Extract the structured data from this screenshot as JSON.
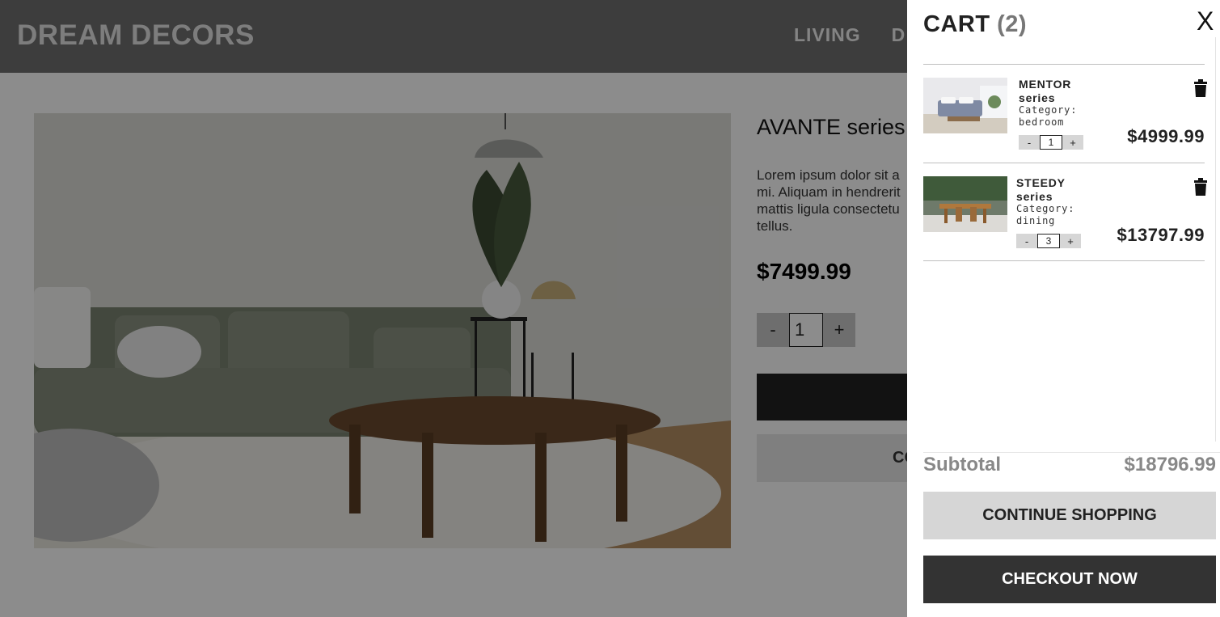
{
  "header": {
    "brand": "DREAM DECORS",
    "nav": [
      "LIVING",
      "D"
    ]
  },
  "product": {
    "title": "AVANTE series",
    "description_lines": [
      "Lorem ipsum dolor sit a",
      "mi. Aliquam in hendrerit",
      "mattis ligula consectetu",
      "tellus."
    ],
    "price": "$7499.99",
    "qty_minus": "-",
    "qty_value": "1",
    "qty_plus": "+",
    "buy_label": "CO"
  },
  "cart": {
    "title": "CART",
    "count": "(2)",
    "close": "X",
    "items": [
      {
        "name": "MENTOR series",
        "category_label": "Category:",
        "category": "bedroom",
        "qty": "1",
        "price": "$4999.99",
        "image": "bedroom-photo"
      },
      {
        "name": "STEEDY series",
        "category_label": "Category:",
        "category": "dining",
        "qty": "3",
        "price": "$13797.99",
        "image": "dining-photo"
      }
    ],
    "minus": "-",
    "plus": "+",
    "subtotal_label": "Subtotal",
    "subtotal_value": "$18796.99",
    "continue_label": "CONTINUE SHOPPING",
    "checkout_label": "CHECKOUT NOW"
  },
  "icons": {
    "close": "close-icon",
    "delete": "trash-icon"
  },
  "colors": {
    "dark": "#333333",
    "button_light": "#d6d6d6",
    "overlay": "rgba(0,0,0,0.45)"
  }
}
